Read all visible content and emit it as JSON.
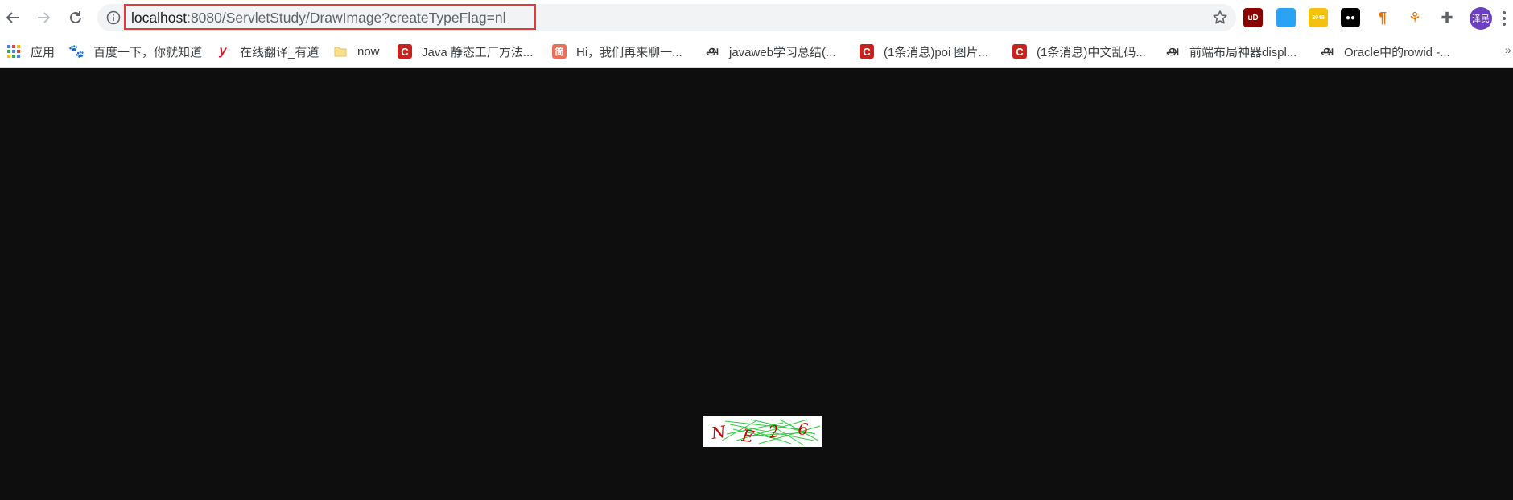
{
  "toolbar": {
    "back_label": "←",
    "forward_label": "→",
    "reload_label": "⟳",
    "url_host": "localhost",
    "url_rest": ":8080/ServletStudy/DrawImage?createTypeFlag=nl",
    "avatar_text": "泽民",
    "extensions": [
      {
        "name": "ublock-icon",
        "text": "uD",
        "bg": "#8b0000",
        "fg": "#ffffff"
      },
      {
        "name": "flower-extension-icon",
        "text": "",
        "bg": "#2aa3f5",
        "fg": "#ffffff"
      },
      {
        "name": "2048-icon",
        "text": "2048",
        "bg": "#f4c20d",
        "fg": "#ffffff"
      },
      {
        "name": "glasses-extension-icon",
        "text": "●●",
        "bg": "#000000",
        "fg": "#ffffff"
      },
      {
        "name": "pilcrow-extension-icon",
        "text": "¶",
        "bg": "#ffffff",
        "fg": "#e8710a"
      },
      {
        "name": "share-extension-icon",
        "text": "⚘",
        "bg": "#ffffff",
        "fg": "#e8710a"
      },
      {
        "name": "puzzle-icon",
        "text": "✚",
        "bg": "#ffffff",
        "fg": "#5f6368"
      }
    ]
  },
  "bookmarks": [
    {
      "label": "应用",
      "icon": "apps-grid-icon"
    },
    {
      "label": "百度一下，你就知道",
      "icon": "baidu-paw-icon"
    },
    {
      "label": "在线翻译_有道",
      "icon": "youdao-icon"
    },
    {
      "label": "now",
      "icon": "folder-icon"
    },
    {
      "label": "Java 静态工厂方法...",
      "icon": "csdn-icon"
    },
    {
      "label": "Hi，我们再来聊一...",
      "icon": "jianshu-icon"
    },
    {
      "label": "javaweb学习总结(...",
      "icon": "cnblogs-icon"
    },
    {
      "label": "(1条消息)poi 图片...",
      "icon": "csdn-icon"
    },
    {
      "label": "(1条消息)中文乱码...",
      "icon": "csdn-icon"
    },
    {
      "label": "前端布局神器displ...",
      "icon": "cnblogs-icon"
    },
    {
      "label": "Oracle中的rowid -...",
      "icon": "cnblogs-icon"
    }
  ],
  "captcha": {
    "chars": [
      "N",
      "E",
      "2",
      "6"
    ],
    "char_color": "#d10000",
    "noise_color": "#2ecc40"
  },
  "colors": {
    "page_bg": "#0e0e0e",
    "highlight": "#e53935"
  }
}
